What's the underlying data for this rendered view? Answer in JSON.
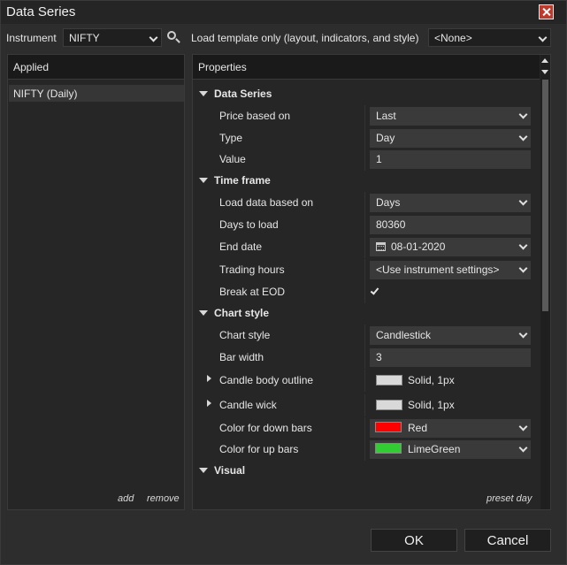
{
  "window": {
    "title": "Data Series"
  },
  "toolbar": {
    "instrument_label": "Instrument",
    "instrument_value": "NIFTY",
    "template_label": "Load template only (layout, indicators, and style)",
    "template_value": "<None>"
  },
  "applied": {
    "header": "Applied",
    "items": [
      {
        "label": "NIFTY (Daily)"
      }
    ],
    "add_label": "add",
    "remove_label": "remove"
  },
  "properties": {
    "header": "Properties",
    "preset_label": "preset day",
    "categories": [
      {
        "label": "Data Series",
        "rows": [
          {
            "label": "Price based on",
            "value": "Last"
          },
          {
            "label": "Type",
            "value": "Day"
          },
          {
            "label": "Value",
            "value": "1"
          }
        ]
      },
      {
        "label": "Time frame",
        "rows": [
          {
            "label": "Load data based on",
            "value": "Days"
          },
          {
            "label": "Days to load",
            "value": "80360"
          },
          {
            "label": "End date",
            "value": "08-01-2020"
          },
          {
            "label": "Trading hours",
            "value": "<Use instrument settings>"
          },
          {
            "label": "Break at EOD",
            "checked": true
          }
        ]
      },
      {
        "label": "Chart style",
        "rows": [
          {
            "label": "Chart style",
            "value": "Candlestick"
          },
          {
            "label": "Bar width",
            "value": "3"
          },
          {
            "label": "Candle body outline",
            "value": "Solid, 1px",
            "swatch": "#d9d9d9"
          },
          {
            "label": "Candle wick",
            "value": "Solid, 1px",
            "swatch": "#d9d9d9"
          },
          {
            "label": "Color for down bars",
            "value": "Red",
            "swatch": "#ff0000"
          },
          {
            "label": "Color for up bars",
            "value": "LimeGreen",
            "swatch": "#32cd32"
          }
        ]
      },
      {
        "label": "Visual",
        "rows": []
      }
    ]
  },
  "buttons": {
    "ok": "OK",
    "cancel": "Cancel"
  }
}
